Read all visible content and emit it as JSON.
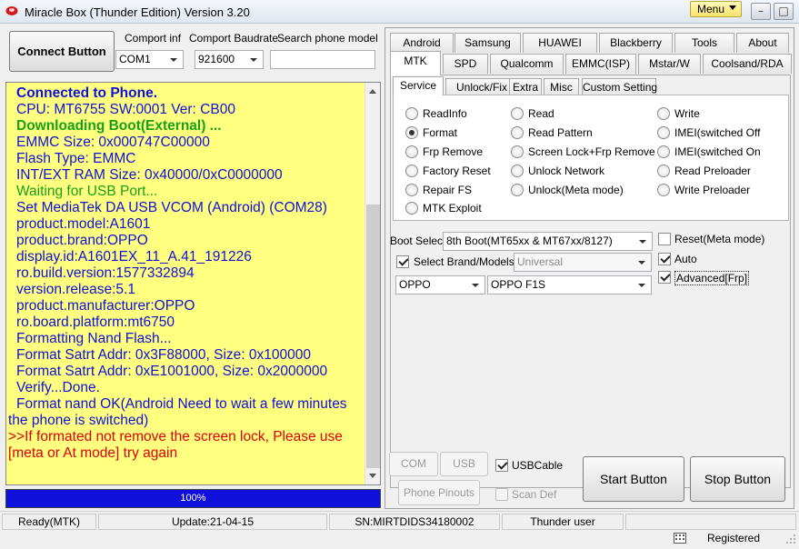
{
  "window": {
    "title": "Miracle Box (Thunder Edition) Version 3.20",
    "menu_label": "Menu",
    "minimize": "–",
    "maximize": "□",
    "close": "✕"
  },
  "toolbar": {
    "connect_label": "Connect Button",
    "comport_label": "Comport inf",
    "comport_value": "COM1",
    "baud_label": "Comport Baudrate",
    "baud_value": "921600",
    "search_label": "Search phone model",
    "search_value": ""
  },
  "log": [
    {
      "text": "Connected to Phone.",
      "style": "bold"
    },
    {
      "text": "CPU: MT6755 SW:0001 Ver: CB00",
      "style": ""
    },
    {
      "text": "Downloading Boot(External) ...",
      "style": "bold green"
    },
    {
      "text": "EMMC Size: 0x000747C00000",
      "style": ""
    },
    {
      "text": "Flash Type: EMMC",
      "style": ""
    },
    {
      "text": "INT/EXT RAM  Size: 0x40000/0xC0000000",
      "style": ""
    },
    {
      "text": "Waiting for USB Port...",
      "style": "green"
    },
    {
      "text": "Set MediaTek DA USB VCOM (Android) (COM28)",
      "style": ""
    },
    {
      "text": "product.model:A1601",
      "style": ""
    },
    {
      "text": "product.brand:OPPO",
      "style": ""
    },
    {
      "text": "display.id:A1601EX_11_A.41_191226",
      "style": ""
    },
    {
      "text": "ro.build.version:1577332894",
      "style": ""
    },
    {
      "text": "version.release:5.1",
      "style": ""
    },
    {
      "text": "product.manufacturer:OPPO",
      "style": ""
    },
    {
      "text": "ro.board.platform:mt6750",
      "style": ""
    },
    {
      "text": "Formatting Nand Flash...",
      "style": ""
    },
    {
      "text": "Format Satrt Addr: 0x3F88000, Size: 0x100000",
      "style": ""
    },
    {
      "text": "Format Satrt Addr: 0xE1001000, Size: 0x2000000",
      "style": ""
    },
    {
      "text": "Verify...Done.",
      "style": ""
    },
    {
      "text": "Format nand OK(Android Need to wait a few minutes",
      "style": ""
    },
    {
      "text": "the phone is switched)",
      "style": "noind"
    },
    {
      "text": ">>If formated not remove the screen lock, Please use",
      "style": "red noind"
    },
    {
      "text": "[meta or At mode] try again",
      "style": "red noind"
    }
  ],
  "progress": {
    "percent": 100,
    "label": "100%",
    "color": "#0f10dc"
  },
  "tabs_row1": [
    "Android",
    "Samsung",
    "HUAWEI",
    "Blackberry",
    "Tools",
    "About"
  ],
  "tabs_row2": [
    "MTK",
    "SPD",
    "Qualcomm",
    "EMMC(ISP)",
    "Mstar/W",
    "Coolsand/RDA"
  ],
  "active_tab": "MTK",
  "subtabs": [
    "Service",
    "Unlock/Fix",
    "Extra",
    "Misc",
    "Custom Setting"
  ],
  "active_subtab": "Service",
  "radios": [
    [
      "ReadInfo",
      "Format",
      "Frp Remove",
      "Factory Reset",
      "Repair FS",
      "MTK Exploit"
    ],
    [
      "Read",
      "Read Pattern",
      "Screen Lock+Frp Remove",
      "Unlock Network",
      "Unlock(Meta mode)"
    ],
    [
      "Write",
      "IMEI(switched Off",
      "IMEI(switched On",
      "Read Preloader",
      "Write Preloader"
    ]
  ],
  "selected_radio": "Format",
  "boot": {
    "label": "Boot Select:",
    "value": "8th Boot(MT65xx & MT67xx/8127)",
    "select_brand_label": "Select Brand/Models",
    "select_brand_checked": true,
    "platform_value": "Universal",
    "brand_value": "OPPO",
    "model_value": "OPPO F1S"
  },
  "options": {
    "reset_meta": {
      "label": "Reset(Meta mode)",
      "checked": false
    },
    "auto": {
      "label": "Auto",
      "checked": true
    },
    "advanced_frp": {
      "label": "Advanced[Frp]",
      "checked": true
    }
  },
  "bottom_controls": {
    "com_scan": "COM Scan",
    "usb_scan": "USB Scan",
    "usb_cable": {
      "label": "USBCable",
      "checked": true
    },
    "phone_pinouts": "Phone Pinouts",
    "scan_def": {
      "label": "Scan Def",
      "checked": false
    },
    "start": "Start Button",
    "stop": "Stop Button"
  },
  "status": {
    "mode": "Ready(MTK)",
    "update": "Update:21-04-15",
    "sn": "SN:MIRTDIDS34180002",
    "user": "Thunder user",
    "registered": "Registered"
  }
}
